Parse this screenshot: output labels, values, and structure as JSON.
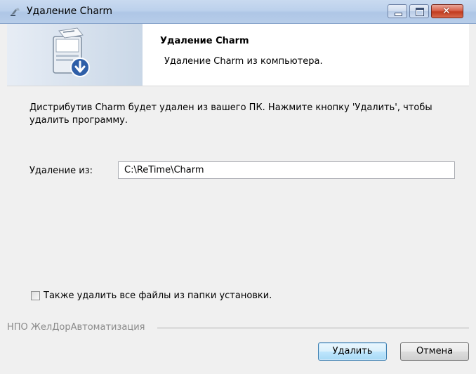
{
  "window": {
    "title": "Удаление Charm",
    "controls": {
      "minimize_icon": "minimize-icon",
      "maximize_icon": "maximize-icon",
      "close_icon": "close-icon"
    }
  },
  "banner": {
    "title": "Удаление Charm",
    "subtitle": "Удаление Charm из компьютера.",
    "icon": "uninstall-computer-icon"
  },
  "body": {
    "description": "Дистрибутив Charm будет удален из вашего ПК. Нажмите кнопку 'Удалить', чтобы удалить программу.",
    "remove_from_label": "Удаление из:",
    "remove_from_value": "C:\\ReTime\\Charm",
    "checkbox_label": "Также удалить все файлы из папки установки.",
    "checkbox_checked": false
  },
  "footer": {
    "company": "НПО ЖелДорАвтоматизация",
    "remove_button": "Удалить",
    "cancel_button": "Отмена"
  },
  "colors": {
    "titlebar": "#bcd1ec",
    "close_button": "#c13a1e",
    "primary_button_border": "#3c7fb1"
  }
}
